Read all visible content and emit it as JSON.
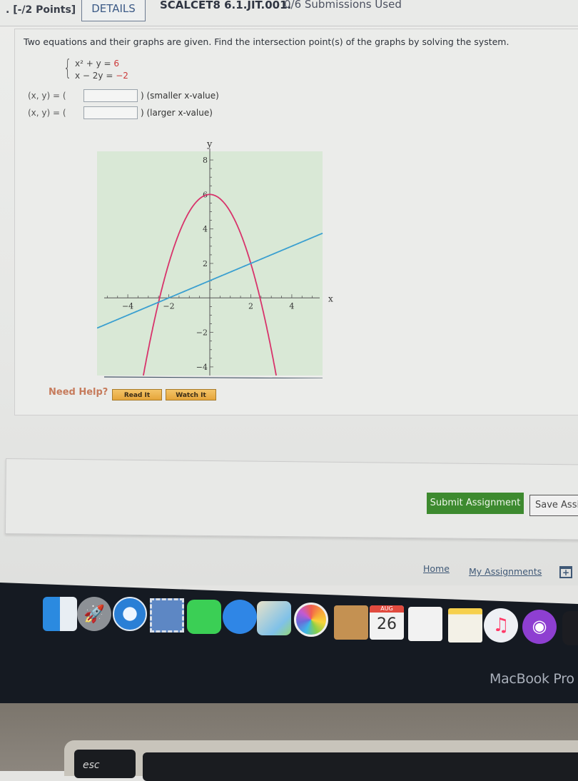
{
  "header": {
    "points": ". [-/2 Points]",
    "details_label": "DETAILS",
    "question_id": "SCALCET8 6.1.JIT.001.",
    "submissions": "0/6 Submissions Used"
  },
  "question": {
    "prompt": "Two equations and their graphs are given. Find the intersection point(s) of the graphs by solving the system.",
    "equations": [
      {
        "lhs": "x² +  y =",
        "rhs": "6"
      },
      {
        "lhs": "x − 2y =",
        "rhs": "−2"
      }
    ],
    "answers": [
      {
        "label": "(x, y) = (",
        "value": "",
        "suffix": ") (smaller x-value)"
      },
      {
        "label": "(x, y) = (",
        "value": "",
        "suffix": ") (larger x-value)"
      }
    ]
  },
  "chart_data": {
    "type": "line",
    "title": "",
    "xlabel": "x",
    "ylabel": "y",
    "xlim": [
      -5.5,
      5.5
    ],
    "ylim": [
      -4.5,
      8.5
    ],
    "x_ticks": [
      -4,
      -2,
      2,
      4
    ],
    "y_ticks": [
      8,
      6,
      4,
      2,
      -2,
      -4
    ],
    "grid": false,
    "series": [
      {
        "name": "x^2 + y = 6",
        "expression": "y = 6 - x^2",
        "color": "#d8336b"
      },
      {
        "name": "x - 2y = -2",
        "expression": "y = (x + 2) / 2",
        "color": "#3a9fd0"
      }
    ],
    "background": "#d9e8d6"
  },
  "help": {
    "label": "Need Help?",
    "read_it": "Read It",
    "watch_it": "Watch It"
  },
  "actions": {
    "submit": "Submit Assignment",
    "save": "Save Assignment Progress"
  },
  "footer": {
    "home": "Home",
    "my_assignments": "My Assignments"
  },
  "dock": {
    "calendar_month": "AUG",
    "calendar_day": "26",
    "apps": [
      "Finder",
      "Launchpad",
      "Safari",
      "Mail",
      "FaceTime",
      "Messages",
      "Maps",
      "Photos",
      "Contacts",
      "Calendar",
      "Reminders",
      "Notes",
      "iTunes",
      "Podcasts",
      "Apple TV"
    ]
  },
  "laptop": {
    "brand": "MacBook Pro",
    "esc_key": "esc"
  }
}
